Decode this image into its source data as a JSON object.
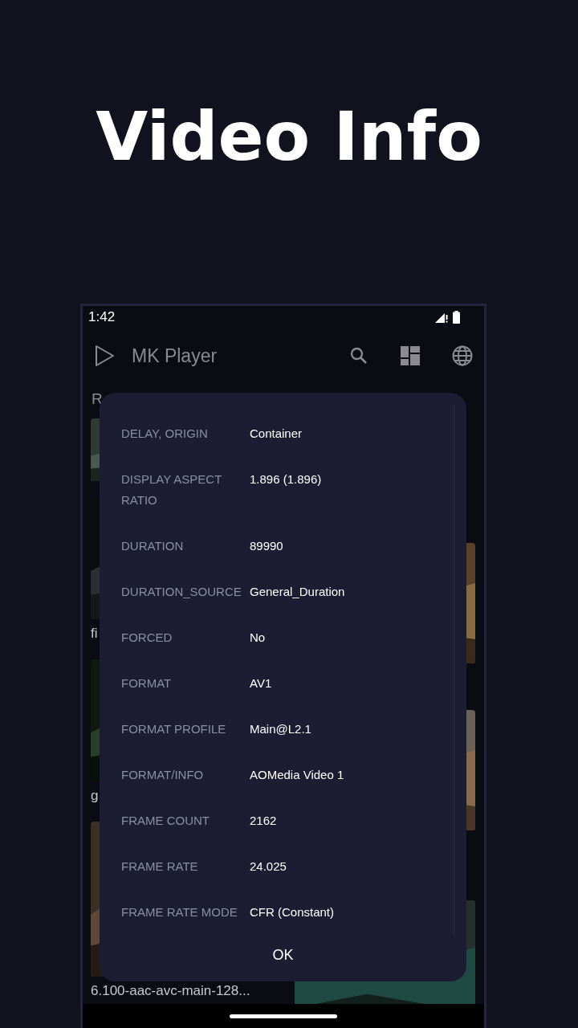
{
  "headline": "Video Info",
  "status_bar": {
    "time": "1:42"
  },
  "app_bar": {
    "title": "MK Player"
  },
  "section": {
    "title": "R"
  },
  "videos": [
    {
      "kind": "picture"
    },
    {
      "kind": "picture",
      "caption": "fi"
    },
    {
      "kind": "picture",
      "caption": "g"
    },
    {
      "kind": "picture",
      "caption": "6.100-aac-avc-main-128..."
    }
  ],
  "dialog": {
    "rows": [
      {
        "label": "DELAY, ORIGIN",
        "value": "Container"
      },
      {
        "label": "DISPLAY ASPECT RATIO",
        "value": "1.896 (1.896)"
      },
      {
        "label": "DURATION",
        "value": "89990"
      },
      {
        "label": "DURATION_SOURCE",
        "value": "General_Duration"
      },
      {
        "label": "FORCED",
        "value": "No"
      },
      {
        "label": "FORMAT",
        "value": "AV1"
      },
      {
        "label": "FORMAT PROFILE",
        "value": "Main@L2.1"
      },
      {
        "label": "FORMAT/INFO",
        "value": "AOMedia Video 1"
      },
      {
        "label": "FRAME COUNT",
        "value": "2162"
      },
      {
        "label": "FRAME RATE",
        "value": "24.025"
      },
      {
        "label": "FRAME RATE MODE",
        "value": "CFR (Constant)"
      }
    ],
    "button": "OK"
  }
}
